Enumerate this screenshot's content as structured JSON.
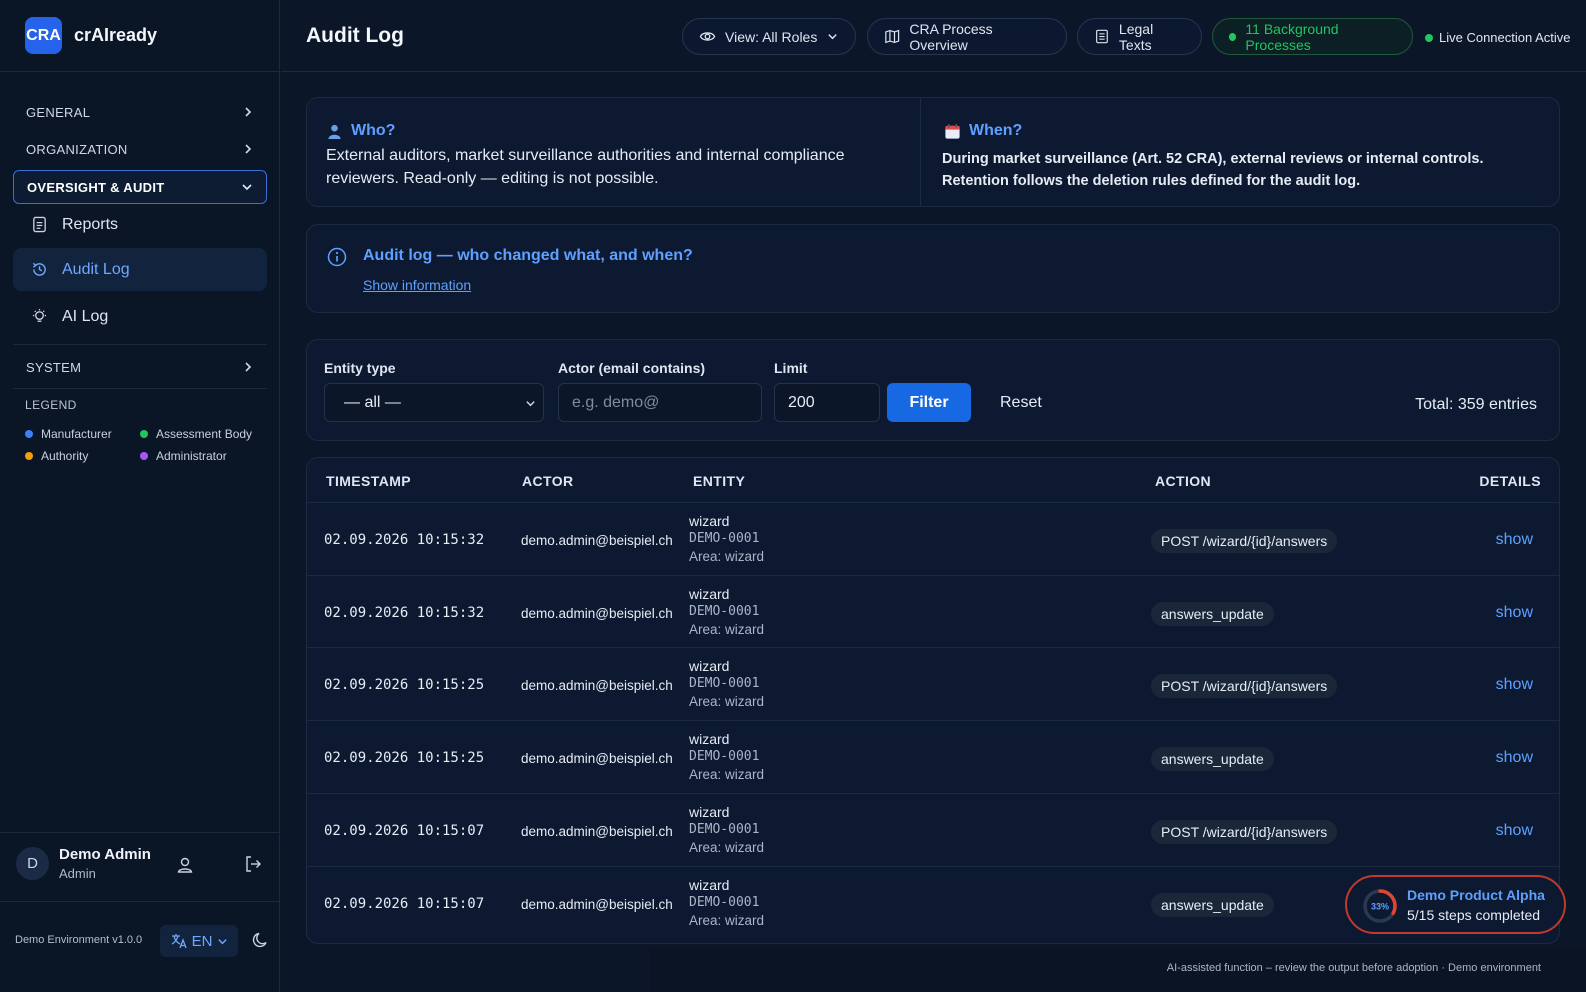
{
  "brand": {
    "logo": "CRA",
    "name": "crAIready"
  },
  "sidebar": {
    "sections": [
      {
        "label": "GENERAL"
      },
      {
        "label": "ORGANIZATION"
      },
      {
        "label": "OVERSIGHT & AUDIT"
      },
      {
        "label": "SYSTEM"
      }
    ],
    "items": [
      {
        "label": "Reports",
        "icon": "report-icon"
      },
      {
        "label": "Audit Log",
        "icon": "audit-icon"
      },
      {
        "label": "AI Log",
        "icon": "bulb-icon"
      }
    ],
    "legend_title": "LEGEND",
    "legend": [
      {
        "label": "Manufacturer",
        "color": "#3b82f6"
      },
      {
        "label": "Assessment Body",
        "color": "#22c55e"
      },
      {
        "label": "Authority",
        "color": "#f59e0b"
      },
      {
        "label": "Administrator",
        "color": "#a855f7"
      }
    ],
    "user": {
      "initial": "D",
      "name": "Demo Admin",
      "role": "Admin"
    },
    "env": "Demo Environment v1.0.0",
    "lang": "EN"
  },
  "header": {
    "title": "Audit Log",
    "view": "View: All Roles",
    "process": "CRA Process Overview",
    "legal": "Legal Texts",
    "background": "11 Background Processes",
    "live": "Live Connection Active"
  },
  "who": {
    "title": "Who?",
    "text": "External auditors, market surveillance authorities and internal compliance reviewers. Read-only — editing is not possible."
  },
  "when": {
    "title": "When?",
    "text": "During market surveillance (Art. 52 CRA), external reviews or internal controls. Retention follows the deletion rules defined for the audit log."
  },
  "info": {
    "title": "Audit log — who changed what, and when?",
    "link": "Show information"
  },
  "filters": {
    "entity_label": "Entity type",
    "entity_value": "— all —",
    "actor_label": "Actor (email contains)",
    "actor_placeholder": "e.g. demo@",
    "limit_label": "Limit",
    "limit_value": "200",
    "filter_btn": "Filter",
    "reset_btn": "Reset",
    "total": "Total: 359 entries"
  },
  "table": {
    "headers": [
      "TIMESTAMP",
      "ACTOR",
      "ENTITY",
      "ACTION",
      "DETAILS"
    ],
    "rows": [
      {
        "ts": "02.09.2026 10:15:32",
        "actor": "demo.admin@beispiel.ch",
        "entity": "wizard",
        "id": "DEMO-0001",
        "area": "Area: wizard",
        "action": "POST /wizard/{id}/answers",
        "details": "show"
      },
      {
        "ts": "02.09.2026 10:15:32",
        "actor": "demo.admin@beispiel.ch",
        "entity": "wizard",
        "id": "DEMO-0001",
        "area": "Area: wizard",
        "action": "answers_update",
        "details": "show"
      },
      {
        "ts": "02.09.2026 10:15:25",
        "actor": "demo.admin@beispiel.ch",
        "entity": "wizard",
        "id": "DEMO-0001",
        "area": "Area: wizard",
        "action": "POST /wizard/{id}/answers",
        "details": "show"
      },
      {
        "ts": "02.09.2026 10:15:25",
        "actor": "demo.admin@beispiel.ch",
        "entity": "wizard",
        "id": "DEMO-0001",
        "area": "Area: wizard",
        "action": "answers_update",
        "details": "show"
      },
      {
        "ts": "02.09.2026 10:15:07",
        "actor": "demo.admin@beispiel.ch",
        "entity": "wizard",
        "id": "DEMO-0001",
        "area": "Area: wizard",
        "action": "POST /wizard/{id}/answers",
        "details": "show"
      },
      {
        "ts": "02.09.2026 10:15:07",
        "actor": "demo.admin@beispiel.ch",
        "entity": "wizard",
        "id": "DEMO-0001",
        "area": "Area: wizard",
        "action": "answers_update",
        "details": ""
      }
    ]
  },
  "footer_note": "AI-assisted function – review the output before adoption · Demo environment",
  "progress": {
    "percent_label": "33%",
    "fraction": 0.33,
    "title": "Demo Product Alpha",
    "sub": "5/15 steps completed"
  }
}
